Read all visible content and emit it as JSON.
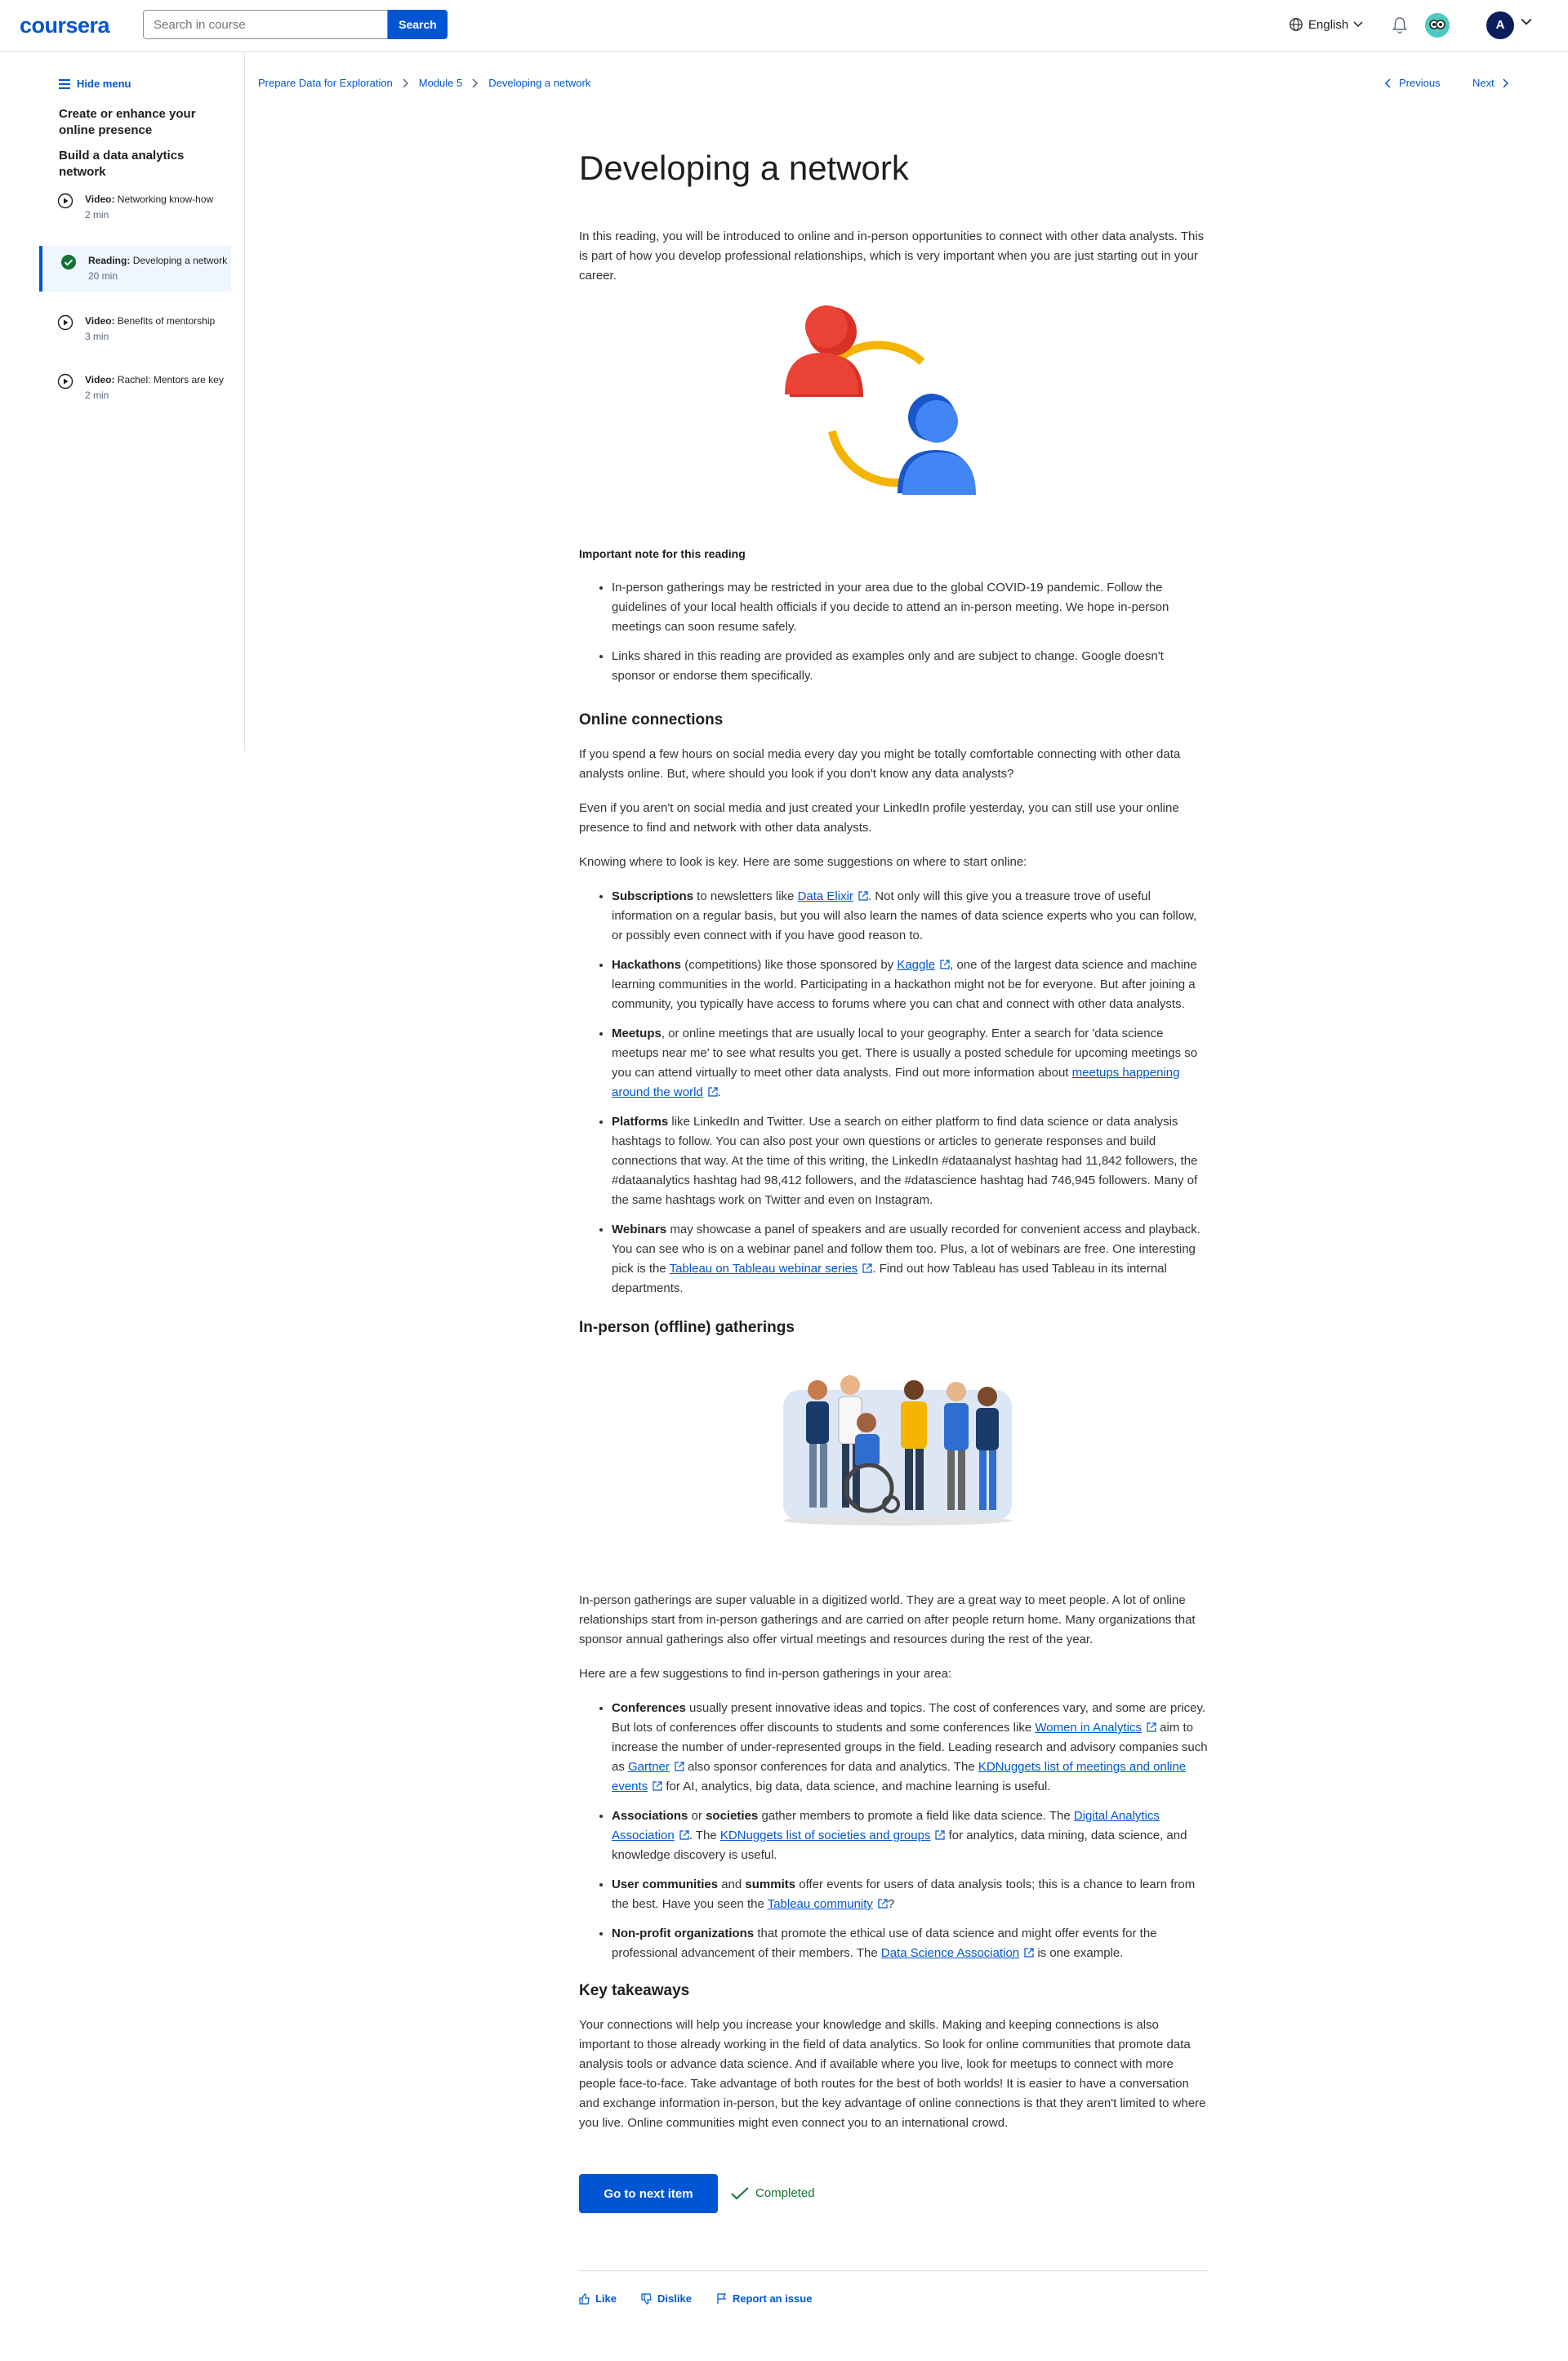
{
  "header": {
    "logo": "coursera",
    "search_placeholder": "Search in course",
    "search_button": "Search",
    "language": "English",
    "avatar_initial": "A"
  },
  "sidebar": {
    "hide_menu": "Hide menu",
    "section1": "Create or enhance your online presence",
    "section2": "Build a data analytics network",
    "items": [
      {
        "kind": "Video:",
        "title": "Networking know-how",
        "duration": "2 min"
      },
      {
        "kind": "Reading:",
        "title": "Developing a network",
        "duration": "20 min"
      },
      {
        "kind": "Video:",
        "title": "Benefits of mentorship",
        "duration": "3 min"
      },
      {
        "kind": "Video:",
        "title": "Rachel: Mentors are key",
        "duration": "2 min"
      }
    ]
  },
  "breadcrumb": {
    "course": "Prepare Data for Exploration",
    "module": "Module 5",
    "item": "Developing a network"
  },
  "nav": {
    "previous": "Previous",
    "next": "Next"
  },
  "article": {
    "title": "Developing a network",
    "intro": "In this reading, you will be introduced to online and in-person opportunities to connect with other data analysts. This is part of how you develop professional relationships, which is very important when you are just starting out in your career.",
    "note_heading": "Important note for this reading",
    "notes": [
      "In-person gatherings may be restricted in your area due to the global COVID-19 pandemic. Follow the guidelines of your local health officials if you decide to attend an in-person meeting. We hope in-person meetings can soon resume safely.",
      "Links shared in this reading are provided as examples only and are subject to change. Google doesn't sponsor or endorse them specifically."
    ],
    "online_heading": "Online connections",
    "online_p1": "If you spend a few hours on social media every day you might be totally comfortable connecting with other data analysts online. But, where should you look if you don't know any data analysts?",
    "online_p2": "Even if you aren't on social media and just created your LinkedIn profile yesterday, you can still use your online presence to find and network with other data analysts.",
    "online_p3": "Knowing where to look is key. Here are some suggestions on where to start online:",
    "online_list": {
      "sub_b": "Subscriptions",
      "sub_t1": " to newsletters like ",
      "sub_link": "Data Elixir",
      "sub_t2": ". Not only will this give you a treasure trove of useful information on a regular basis, but you will also learn the names of data science experts who you can follow, or possibly even connect with if you have good reason to.",
      "hack_b": "Hackathons",
      "hack_t1": " (competitions) like those sponsored by ",
      "hack_link": "Kaggle",
      "hack_t2": ", one of the largest data science and machine learning communities in the world. Participating in a hackathon might not be for everyone. But after joining a community, you typically have access to forums where you can chat and connect with other data analysts.",
      "meet_b": "Meetups",
      "meet_t1": ", or online meetings that are usually local to your geography. Enter a search for 'data science meetups near me' to see what results you get. There is usually a posted schedule for upcoming meetings so you can attend virtually to meet other data analysts. Find out more information about ",
      "meet_link": "meetups happening around the world",
      "meet_t2": ".",
      "plat_b": "Platforms",
      "plat_t1": " like LinkedIn and Twitter. Use a search on either platform to find data science or data analysis hashtags to follow. You can also post your own questions or articles to generate responses and build connections that way. At the time of this writing, the LinkedIn #dataanalyst hashtag had 11,842 followers, the #dataanalytics hashtag had 98,412 followers, and the #datascience hashtag had 746,945 followers. Many of the same hashtags work on Twitter and even on Instagram.",
      "web_b": "Webinars",
      "web_t1": " may showcase a panel of speakers and are usually recorded for convenient access and playback. You can see who is on a webinar panel and follow them too. Plus, a lot of webinars are free. One interesting pick is the ",
      "web_link": "Tableau on Tableau webinar series",
      "web_t2": ". Find out how Tableau has used Tableau in its internal departments."
    },
    "offline_heading": "In-person (offline) gatherings",
    "offline_p1": "In-person gatherings are super valuable in a digitized world. They are a great way to meet people. A lot of online relationships start from in-person gatherings and are carried on after people return home. Many organizations that sponsor annual gatherings also offer virtual meetings and resources during the rest of the year.",
    "offline_p2": "Here are a few suggestions to find in-person gatherings in your area:",
    "offline_list": {
      "conf_b": "Conferences",
      "conf_t1": " usually present innovative ideas and topics. The cost of conferences vary, and some are pricey. But lots of conferences offer discounts to students and some conferences like ",
      "conf_link1": "Women in Analytics",
      "conf_t2": " aim to increase the number of under-represented groups in the field. Leading research and advisory companies such as ",
      "conf_link2": "Gartner",
      "conf_t3": " also sponsor conferences for data and analytics. The ",
      "conf_link3": "KDNuggets list of meetings and online events",
      "conf_t4": " for AI, analytics, big data, data science, and machine learning is useful.",
      "assoc_b1": "Associations",
      "assoc_t1": " or ",
      "assoc_b2": "societies",
      "assoc_t2": " gather members to promote a field like data science. The ",
      "assoc_link1": "Digital Analytics Association",
      "assoc_t3": ". The ",
      "assoc_link2": "KDNuggets list of societies and groups",
      "assoc_t4": " for analytics, data mining, data science, and knowledge discovery is useful.",
      "uc_b1": "User communities",
      "uc_t1": " and ",
      "uc_b2": "summits",
      "uc_t2": " offer events for users of data analysis tools; this is a chance to learn from the best. Have you seen the ",
      "uc_link": "Tableau community",
      "uc_t3": "?",
      "np_b": "Non-profit organizations",
      "np_t1": " that promote the ethical use of data science and might offer events for the professional advancement of their members. The ",
      "np_link": "Data Science Association",
      "np_t2": " is one example."
    },
    "takeaways_heading": "Key takeaways",
    "takeaways": "Your connections will help you increase your knowledge and skills. Making and keeping connections is also important to those already working in the field of data analytics. So look for online communities that promote data analysis tools or advance data science. And if available where you live, look for meetups to connect with more people face-to-face. Take advantage of both routes for the best of both worlds!  It is easier to have a conversation and exchange information in-person, but the key advantage of online connections is that they aren't limited to where you live. Online communities might even connect you to an international crowd."
  },
  "footer": {
    "next_button": "Go to next item",
    "completed": "Completed",
    "like": "Like",
    "dislike": "Dislike",
    "report": "Report an issue"
  },
  "colors": {
    "accent": "#0056d2",
    "completed": "#137333"
  }
}
